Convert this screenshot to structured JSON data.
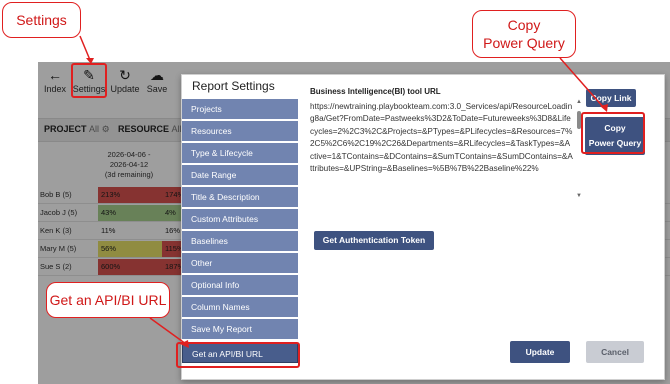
{
  "toolbar": {
    "items": [
      {
        "label": "Index",
        "icon": "arrow-left-icon"
      },
      {
        "label": "Settings",
        "icon": "pencil-icon"
      },
      {
        "label": "Update",
        "icon": "refresh-icon"
      },
      {
        "label": "Save",
        "icon": "cloud-upload-icon"
      }
    ]
  },
  "filterbar": {
    "project_label": "PROJECT",
    "project_value": "All",
    "resource_label": "RESOURCE",
    "resource_value": "All"
  },
  "grid": {
    "column_header": [
      "2026-04-06 -",
      "2026-04-12",
      "(3d remaining)"
    ],
    "rows": [
      {
        "name": "Bob B (5)",
        "c1": "213%",
        "c2": "174%",
        "c1_color": "#d9534f",
        "c2_color": "#d9534f"
      },
      {
        "name": "Jacob J (5)",
        "c1": "43%",
        "c2": "4%",
        "c1_color": "#a9d18e",
        "c2_color": "#a9d18e"
      },
      {
        "name": "Ken K (3)",
        "c1": "11%",
        "c2": "16%",
        "c1_color": "#ffffff",
        "c2_color": "#ffffff"
      },
      {
        "name": "Mary M (5)",
        "c1": "56%",
        "c2": "115%",
        "c1_color": "#e8e26a",
        "c2_color": "#d9534f"
      },
      {
        "name": "Sue S (2)",
        "c1": "600%",
        "c2": "187%",
        "c1_color": "#d9534f",
        "c2_color": "#d9534f"
      }
    ]
  },
  "modal": {
    "title": "Report Settings",
    "nav": [
      "Projects",
      "Resources",
      "Type & Lifecycle",
      "Date Range",
      "Title & Description",
      "Custom Attributes",
      "Baselines",
      "Other",
      "Optional Info",
      "Column Names",
      "Save My Report",
      "Get an API/BI URL"
    ],
    "bi_label": "Business Intelligence(BI) tool URL",
    "url": "https://newtraining.playbookteam.com:3.0_Services/api/ResourceLoading8a/Get?FromDate=Pastweeks%3D2&ToDate=Futureweeks%3D8&Lifecycles=2%2C3%2C&Projects=&PTypes=&PLifecycles=&Resources=7%2C5%2C6%2C19%2C26&Departments=&RLifecycles=&TaskTypes=&Active=1&TContains=&DContains=&SumTContains=&SumDContains=&Attributes=&UPString=&Baselines=%5B%7B%22Baseline%22%",
    "copy_link": "Copy Link",
    "copy_pq_line1": "Copy",
    "copy_pq_line2": "Power Query",
    "auth_button": "Get Authentication Token",
    "update_button": "Update",
    "cancel_button": "Cancel"
  },
  "callouts": {
    "settings": "Settings",
    "copy_line1": "Copy",
    "copy_line2": "Power Query",
    "api": "Get an API/BI URL"
  },
  "colors": {
    "nav": "#7184b0",
    "nav_active": "#485d8c",
    "button": "#3e5280",
    "callout": "#e02020"
  }
}
